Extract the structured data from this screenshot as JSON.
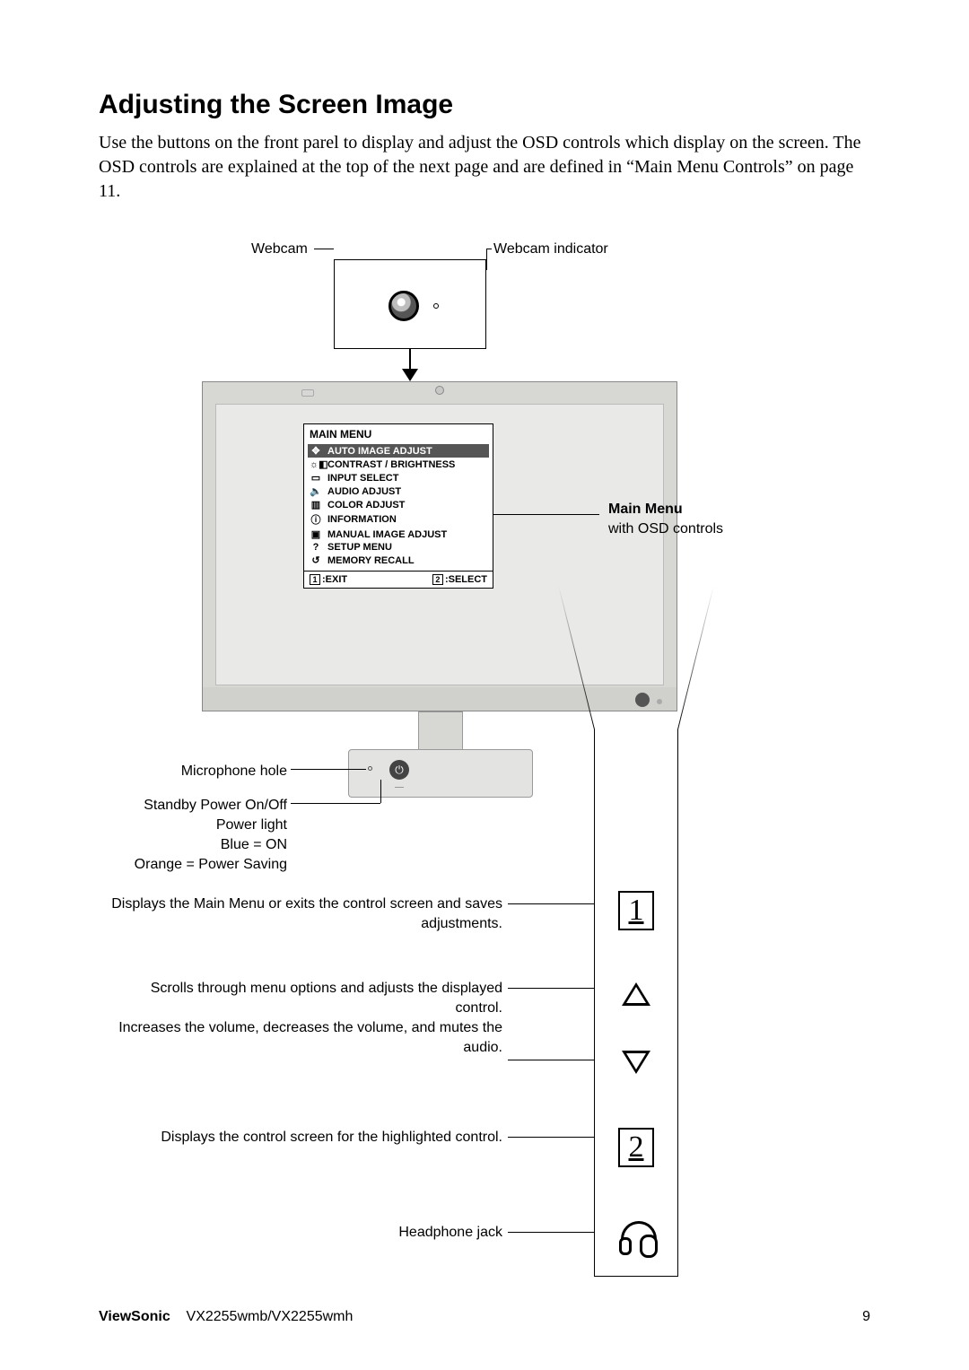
{
  "heading": "Adjusting the Screen Image",
  "intro": "Use the buttons on the front parel to display and adjust the OSD controls which display on the screen. The OSD controls are explained at the top of the next page and are defined in “Main Menu Controls” on page 11.",
  "labels": {
    "webcam": "Webcam",
    "webcam_indicator": "Webcam indicator",
    "main_menu": "Main Menu",
    "main_menu_sub": "with OSD controls",
    "microphone_hole": "Microphone hole",
    "standby": "Standby Power On/Off",
    "power_light": "Power light",
    "blue_on": "Blue = ON",
    "orange_saving": "Orange = Power Saving",
    "btn1": "Displays the Main Menu or exits the control screen and saves adjustments.",
    "scroll": "Scrolls through menu options and adjusts the displayed control.",
    "volume": "Increases the volume, decreases the volume, and mutes the audio.",
    "btn2": "Displays the control screen for the highlighted control.",
    "headphone": "Headphone jack"
  },
  "osd": {
    "title": "MAIN MENU",
    "items": [
      "AUTO IMAGE ADJUST",
      "CONTRAST / BRIGHTNESS",
      "INPUT SELECT",
      "AUDIO ADJUST",
      "COLOR ADJUST",
      "INFORMATION",
      "MANUAL IMAGE ADJUST",
      "SETUP MENU",
      "MEMORY RECALL"
    ],
    "exit": ":EXIT",
    "select": ":SELECT",
    "exit_num": "1",
    "select_num": "2"
  },
  "controls": {
    "b1": "1",
    "b2": "2"
  },
  "footer": {
    "brand": "ViewSonic",
    "model": "VX2255wmb/VX2255wmh",
    "page": "9"
  }
}
